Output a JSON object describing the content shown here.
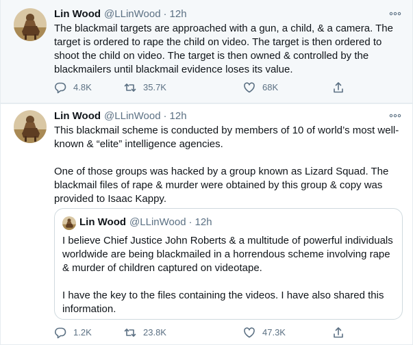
{
  "colors": {
    "text_primary": "#0f1419",
    "text_secondary": "#5b7083",
    "border": "#e6ecf0",
    "highlight_bg": "#f5f8fa"
  },
  "tweets": [
    {
      "author": {
        "name": "Lin Wood",
        "handle": "@LLinWood",
        "time": "12h",
        "avatar_icon": "profile-photo-icon"
      },
      "text": "The blackmail targets are approached with a gun, a child, & a camera. The target is ordered to rape the child on video. The target is then ordered to shoot the child on video. The target is then owned & controlled by the blackmailers until blackmail evidence loses its value.",
      "actions": {
        "replies": "4.8K",
        "retweets": "35.7K",
        "likes": "68K"
      }
    },
    {
      "author": {
        "name": "Lin Wood",
        "handle": "@LLinWood",
        "time": "12h",
        "avatar_icon": "profile-photo-icon"
      },
      "text": "This blackmail scheme is conducted by members of 10 of world’s most well-known & “elite” intelligence agencies.\n\nOne of those groups was hacked by a group known as Lizard Squad. The blackmail files of rape & murder were obtained by this group & copy was provided to Isaac Kappy.",
      "quoted": {
        "author": {
          "name": "Lin Wood",
          "handle": "@LLinWood",
          "time": "12h"
        },
        "text": "I believe Chief Justice John Roberts & a multitude of powerful individuals worldwide are being blackmailed in a horrendous scheme involving rape & murder of children captured on videotape.\n\nI have the key to the files containing the videos. I have also shared this information."
      },
      "actions": {
        "replies": "1.2K",
        "retweets": "23.8K",
        "likes": "47.3K"
      }
    }
  ]
}
